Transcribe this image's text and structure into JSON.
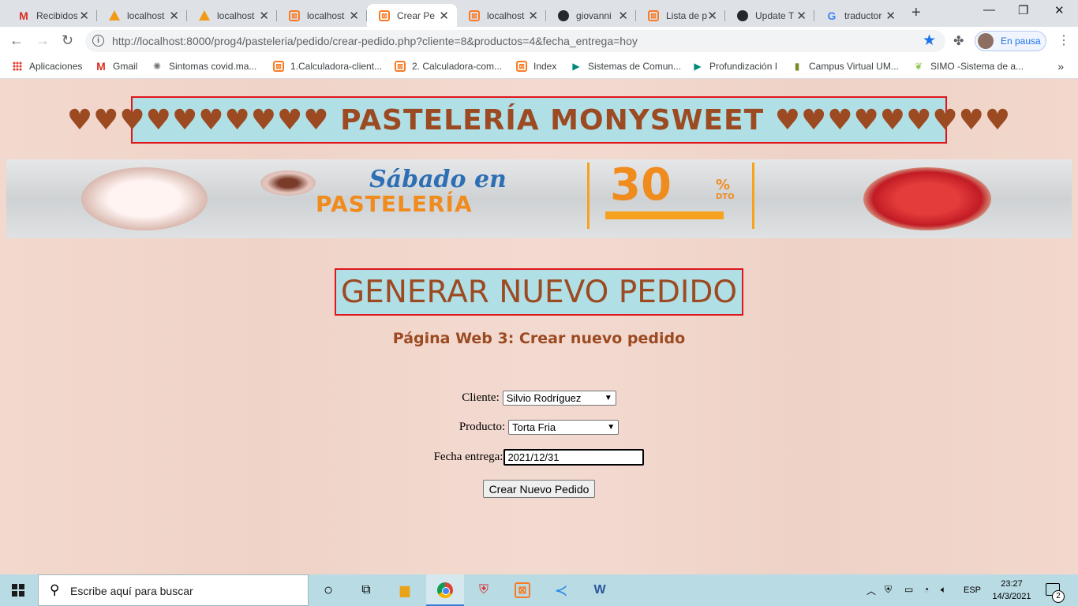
{
  "browser": {
    "tabs": [
      {
        "icon": "gmail-icon",
        "label": "Recibidos"
      },
      {
        "icon": "phpmyadmin-icon",
        "label": "localhost"
      },
      {
        "icon": "phpmyadmin-icon",
        "label": "localhost"
      },
      {
        "icon": "xampp-icon",
        "label": "localhost"
      },
      {
        "icon": "xampp-icon",
        "label": "Crear Pe",
        "active": true
      },
      {
        "icon": "xampp-icon",
        "label": "localhost"
      },
      {
        "icon": "github-icon",
        "label": "giovanni"
      },
      {
        "icon": "xampp-icon",
        "label": "Lista de p"
      },
      {
        "icon": "github-icon",
        "label": "Update T"
      },
      {
        "icon": "google-icon",
        "label": "traductor"
      }
    ],
    "url": "http://localhost:8000/prog4/pasteleria/pedido/crear-pedido.php?cliente=8&productos=4&fecha_entrega=hoy",
    "profile_label": "En pausa",
    "bookmarks": [
      {
        "icon": "apps-icon",
        "label": "Aplicaciones"
      },
      {
        "icon": "gmail-icon",
        "label": "Gmail"
      },
      {
        "icon": "virus-icon",
        "label": "Sintomas covid.ma..."
      },
      {
        "icon": "xampp-icon",
        "label": "1.Calculadora-client..."
      },
      {
        "icon": "xampp-icon",
        "label": "2. Calculadora-com..."
      },
      {
        "icon": "xampp-icon",
        "label": "Index"
      },
      {
        "icon": "meet-icon",
        "label": "Sistemas de Comun..."
      },
      {
        "icon": "meet-icon",
        "label": "Profundización I"
      },
      {
        "icon": "campus-icon",
        "label": "Campus Virtual UM..."
      },
      {
        "icon": "leaf-icon",
        "label": "SIMO -Sistema de a..."
      }
    ],
    "bookmarks_more": "»"
  },
  "page": {
    "header_title": "♥♥♥♥♥♥♥♥♥♥ PASTELERÍA MONYSWEET ♥♥♥♥♥♥♥♥♥",
    "banner": {
      "line1": "Sábado en",
      "line2": "PASTELERÍA",
      "discount": "30",
      "percent": "%",
      "dto": "DTO"
    },
    "heading": "GENERAR NUEVO PEDIDO",
    "subtitle": "Página Web 3: Crear nuevo pedido",
    "form": {
      "cliente_label": "Cliente:",
      "cliente_value": "Silvio Rodríguez",
      "producto_label": "Producto:",
      "producto_value": "Torta Fria",
      "fecha_label": "Fecha entrega:",
      "fecha_value": "2021/12/31",
      "submit_label": "Crear Nuevo Pedido"
    }
  },
  "taskbar": {
    "search_placeholder": "Escribe aquí para buscar",
    "language": "ESP",
    "time": "23:27",
    "date": "14/3/2021",
    "notification_count": "2"
  }
}
